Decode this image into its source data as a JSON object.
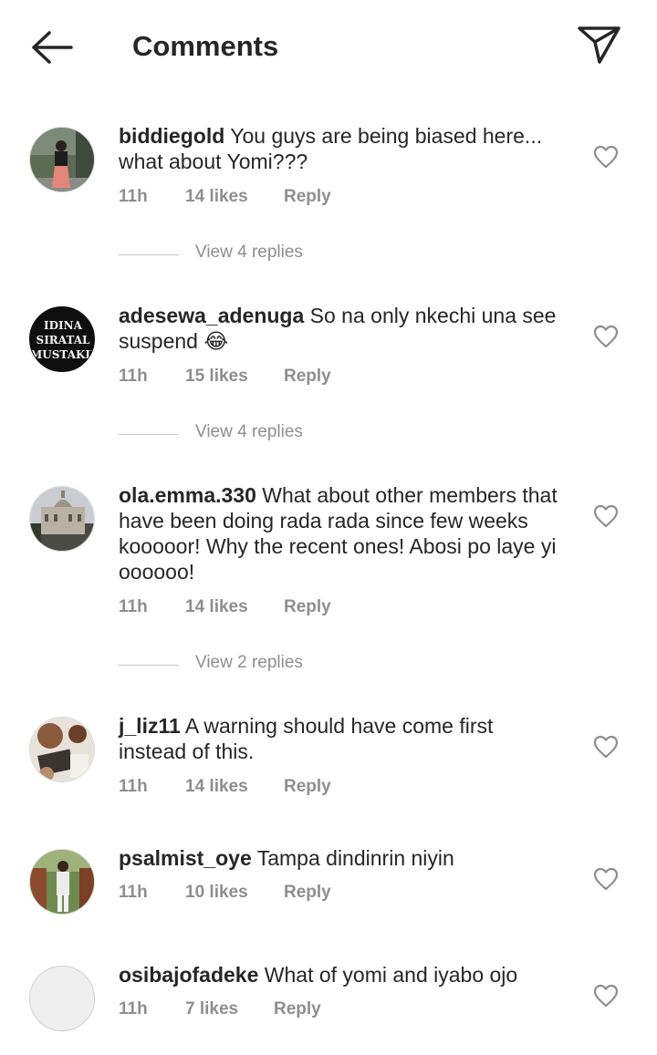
{
  "header": {
    "title": "Comments",
    "back_icon": "arrow-left-icon",
    "send_icon": "paper-plane-icon"
  },
  "comments": [
    {
      "username": "biddiegold",
      "text": "You guys are being biased here... what about Yomi???",
      "time": "11h",
      "likes": "14 likes",
      "reply": "Reply",
      "view_replies": "View 4 replies",
      "avatar": "photo-woman-street"
    },
    {
      "username": "adesewa_adenuga",
      "text": "So na only nkechi una see suspend",
      "emoji": "😂",
      "time": "11h",
      "likes": "15 likes",
      "reply": "Reply",
      "view_replies": "View 4 replies",
      "avatar_text": [
        "IDINA",
        "SIRATAL",
        "MUSTAKIM"
      ]
    },
    {
      "username": "ola.emma.330",
      "text": "What about other members that have been doing rada rada since few weeks kooooor! Why the recent ones! Abosi po laye yi oooooo!",
      "time": "11h",
      "likes": "14 likes",
      "reply": "Reply",
      "view_replies": "View 2 replies",
      "avatar": "photo-building"
    },
    {
      "username": "j_liz11",
      "text": "A warning should have come first instead of this.",
      "time": "11h",
      "likes": "14 likes",
      "reply": "Reply",
      "avatar": "photo-objects"
    },
    {
      "username": "psalmist_oye",
      "text": "Tampa dindinrin niyin",
      "time": "11h",
      "likes": "10 likes",
      "reply": "Reply",
      "avatar": "photo-man-outdoor"
    },
    {
      "username": "osibajofadeke",
      "text": "What of yomi and iyabo ojo",
      "time": "11h",
      "likes": "7 likes",
      "reply": "Reply",
      "avatar": "default-avatar"
    }
  ],
  "colors": {
    "text": "#262626",
    "meta": "#8e8e8e",
    "divider": "#c7c7c7"
  }
}
